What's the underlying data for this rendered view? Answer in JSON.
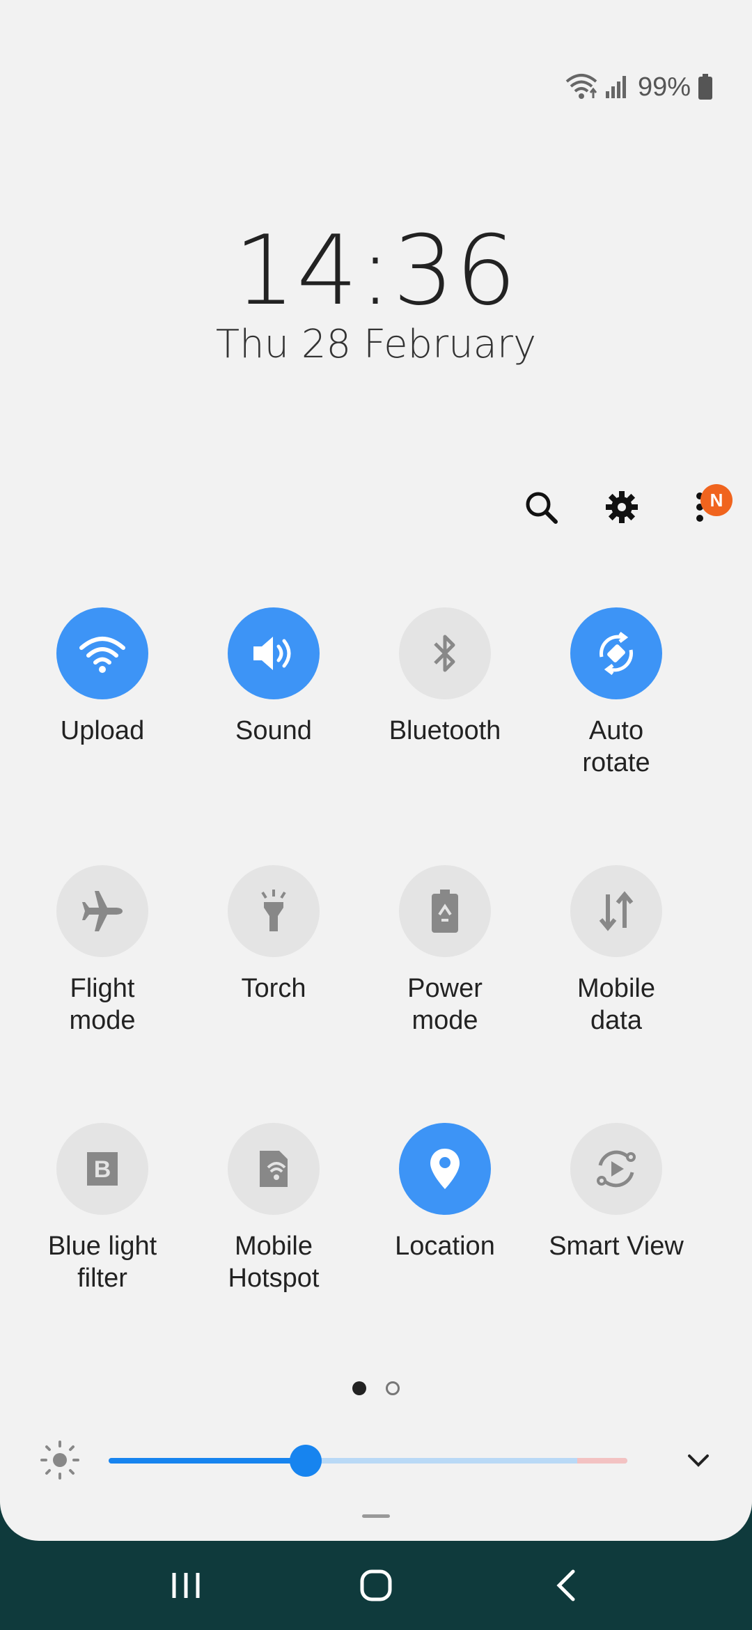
{
  "status": {
    "battery_percent": "99%"
  },
  "clock": {
    "time": "14:36",
    "date": "Thu 28 February"
  },
  "toolbar": {
    "badge": "N"
  },
  "tiles": [
    {
      "label": "Upload",
      "on": true,
      "icon": "wifi-icon"
    },
    {
      "label": "Sound",
      "on": true,
      "icon": "sound-icon"
    },
    {
      "label": "Bluetooth",
      "on": false,
      "icon": "bluetooth-icon"
    },
    {
      "label": "Auto\nrotate",
      "on": true,
      "icon": "auto-rotate-icon"
    },
    {
      "label": "Flight\nmode",
      "on": false,
      "icon": "airplane-icon"
    },
    {
      "label": "Torch",
      "on": false,
      "icon": "torch-icon"
    },
    {
      "label": "Power\nmode",
      "on": false,
      "icon": "power-mode-icon"
    },
    {
      "label": "Mobile\ndata",
      "on": false,
      "icon": "mobile-data-icon"
    },
    {
      "label": "Blue light\nfilter",
      "on": false,
      "icon": "blue-light-filter-icon"
    },
    {
      "label": "Mobile\nHotspot",
      "on": false,
      "icon": "hotspot-icon"
    },
    {
      "label": "Location",
      "on": true,
      "icon": "location-pin-icon"
    },
    {
      "label": "Smart View",
      "on": false,
      "icon": "smart-view-icon"
    }
  ],
  "brightness": {
    "level": 0.38
  },
  "colors": {
    "accent": "#3d94f6",
    "panel": "#f2f2f2",
    "badge": "#f0641e"
  }
}
